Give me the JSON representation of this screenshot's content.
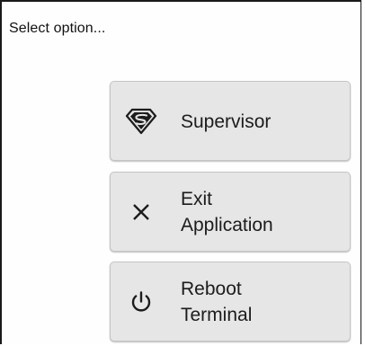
{
  "dialog": {
    "title": "Select option..."
  },
  "options": [
    {
      "label": "Supervisor",
      "icon": "superman-shield-icon"
    },
    {
      "label_line1": "Exit",
      "label_line2": "Application",
      "icon": "close-icon"
    },
    {
      "label_line1": "Reboot",
      "label_line2": "Terminal",
      "icon": "power-icon"
    }
  ],
  "colors": {
    "button_background": "#e6e6e6",
    "text": "#1c1c1c",
    "dialog_border": "#1a1a1a"
  }
}
